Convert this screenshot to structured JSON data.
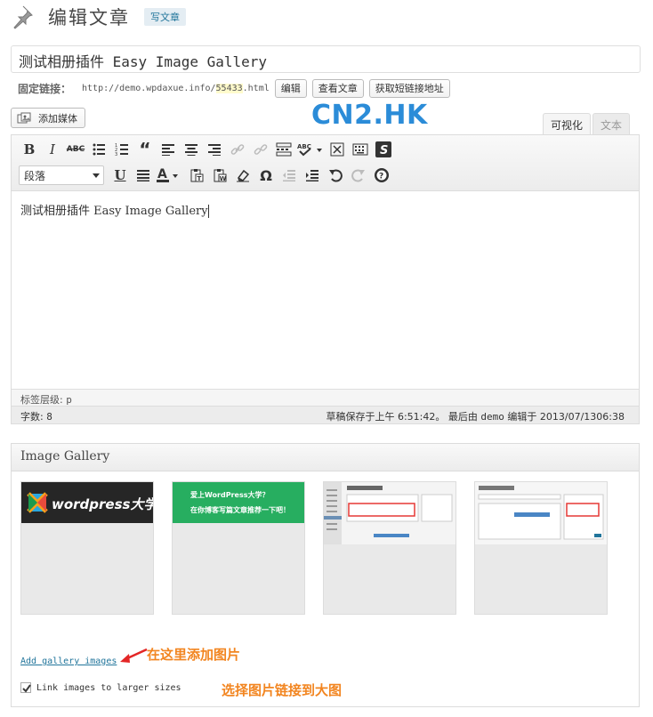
{
  "header": {
    "title": "编辑文章",
    "new_post": "写文章"
  },
  "post": {
    "title": "测试相册插件 Easy Image Gallery"
  },
  "permalink": {
    "label": "固定链接：",
    "url_prefix": "http://demo.wpdaxue.info/",
    "slug": "55433",
    "url_suffix": ".html",
    "edit_button": "编辑",
    "view_button": "查看文章",
    "shortlink_button": "获取短链接地址"
  },
  "media": {
    "add_media": "添加媒体"
  },
  "watermark": "CN2.HK",
  "tabs": {
    "visual": "可视化",
    "text": "文本"
  },
  "toolbar": {
    "format_value": "段落",
    "colors": {
      "text_color": "#333333",
      "accent": "#21759b"
    }
  },
  "editor": {
    "content": "测试相册插件 Easy Image Gallery",
    "path_label": "标签层级:",
    "path_value": "p"
  },
  "status": {
    "word_count_label": "字数:",
    "word_count": "8",
    "draft_saved": "草稿保存于上午 6:51:42。 最后由",
    "last_editor": "demo",
    "edited_at": "编辑于 2013/07/1306:38"
  },
  "gallery": {
    "title": "Image Gallery",
    "thumb1_logo": "wordpress大学",
    "thumb2_line1": "爱上WordPress大学？",
    "thumb2_line2": "在你博客写篇文章推荐一下吧！",
    "add_images": "Add gallery images",
    "link_checkbox_label": "Link images to larger sizes",
    "link_checked": true,
    "annotation_add": "在这里添加图片",
    "annotation_link": "选择图片链接到大图"
  }
}
